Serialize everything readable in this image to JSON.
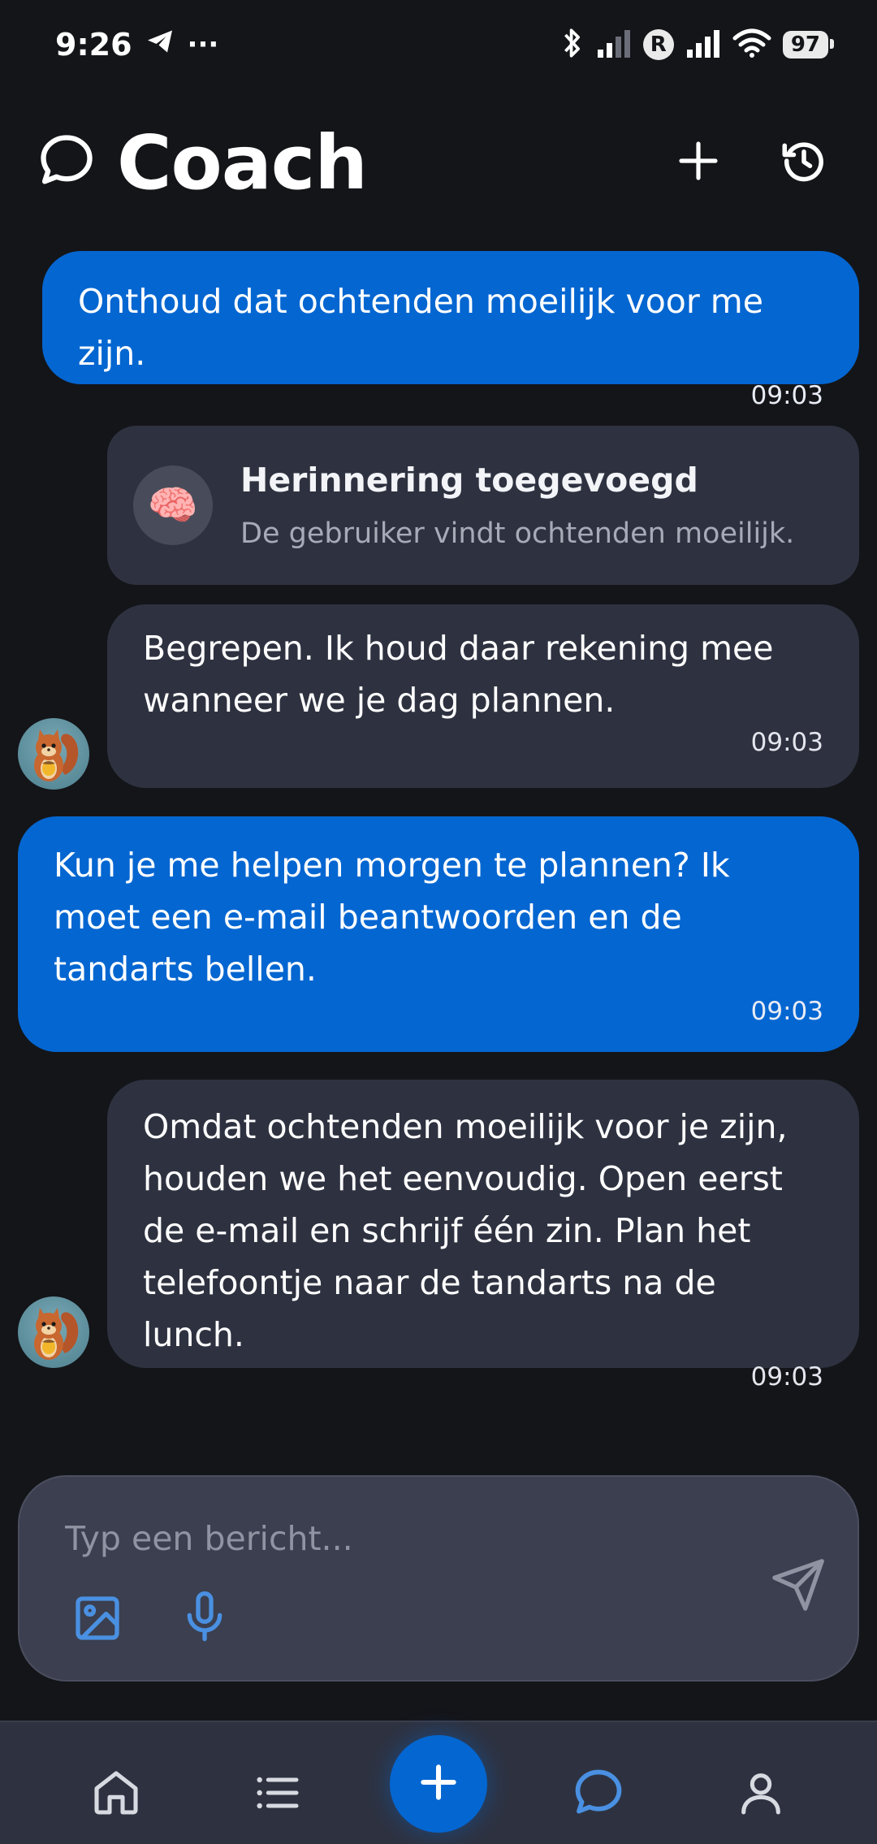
{
  "status_bar": {
    "time": "9:26",
    "more": "···",
    "battery": "97",
    "roaming": "R"
  },
  "header": {
    "title": "Coach"
  },
  "messages": [
    {
      "role": "user",
      "text": "Onthoud dat ochtenden moeilijk voor me zijn.",
      "time": "09:03"
    },
    {
      "role": "bot",
      "text": "Begrepen. Ik houd daar rekening mee wanneer we je dag plannen.",
      "time": "09:03"
    },
    {
      "role": "user",
      "text": "Kun je me helpen morgen te plannen? Ik moet een e-mail beantwoorden en de tandarts bellen.",
      "time": "09:03"
    },
    {
      "role": "bot",
      "text": "Omdat ochtenden moeilijk voor je zijn, houden we het eenvoudig. Open eerst de e-mail en schrijf één zin. Plan het telefoontje naar de tandarts na de lunch.",
      "time": "09:03"
    }
  ],
  "memory_card": {
    "icon": "🧠",
    "title": "Herinnering toegevoegd",
    "subtitle": "De gebruiker vindt ochtenden moeilijk."
  },
  "composer": {
    "placeholder": "Typ een bericht..."
  },
  "colors": {
    "accent": "#0466d1",
    "background": "#141519",
    "bubble_bot": "#2e3240",
    "icon_blue": "#4a90e2"
  }
}
